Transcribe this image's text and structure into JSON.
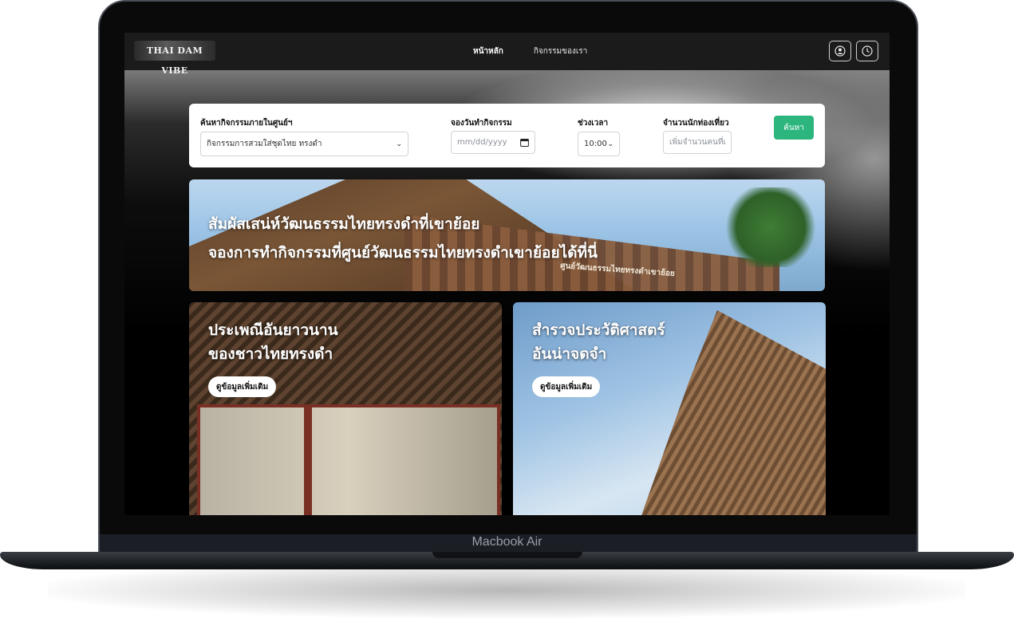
{
  "device": {
    "label": "Macbook Air"
  },
  "navbar": {
    "logo_text": "THAI DAM VIBE",
    "links": [
      {
        "label": "หน้าหลัก",
        "active": true
      },
      {
        "label": "กิจกรรมของเรา",
        "active": false
      }
    ],
    "icons": [
      "user-circle-icon",
      "clock-icon"
    ]
  },
  "search": {
    "activity": {
      "label": "ค้นหากิจกรรมภายในศูนย์ฯ",
      "selected": "กิจกรรมการสวมใส่ชุดไทย ทรงดำ"
    },
    "date": {
      "label": "จองวันทำกิจกรรม",
      "placeholder": "mm/dd/yyyy"
    },
    "time": {
      "label": "ช่วงเวลา",
      "selected": "10:00"
    },
    "visitors": {
      "label": "จำนวนนักท่องเที่ยว",
      "placeholder": "เพิ่มจำนวนคนที่เ"
    },
    "submit_label": "ค้นหา",
    "accent_color": "#2cb67d"
  },
  "banner": {
    "line1": "สัมผัสเสน่ห์วัฒนธรรมไทยทรงดำที่เขาย้อย",
    "line2": "จองการทำกิจกรรมที่ศูนย์วัฒนธรรมไทยทรงดำเขาย้อยได้ที่นี่",
    "sign_text": "ศูนย์วัฒนธรรมไทยทรงดำเขาย้อย"
  },
  "cards": [
    {
      "line1": "ประเพณีอันยาวนาน",
      "line2": "ของชาวไทยทรงดำ",
      "button": "ดูข้อมูลเพิ่มเติม"
    },
    {
      "line1": "สำรวจประวัติศาสตร์",
      "line2": "อันน่าจดจำ",
      "button": "ดูข้อมูลเพิ่มเติม"
    }
  ]
}
